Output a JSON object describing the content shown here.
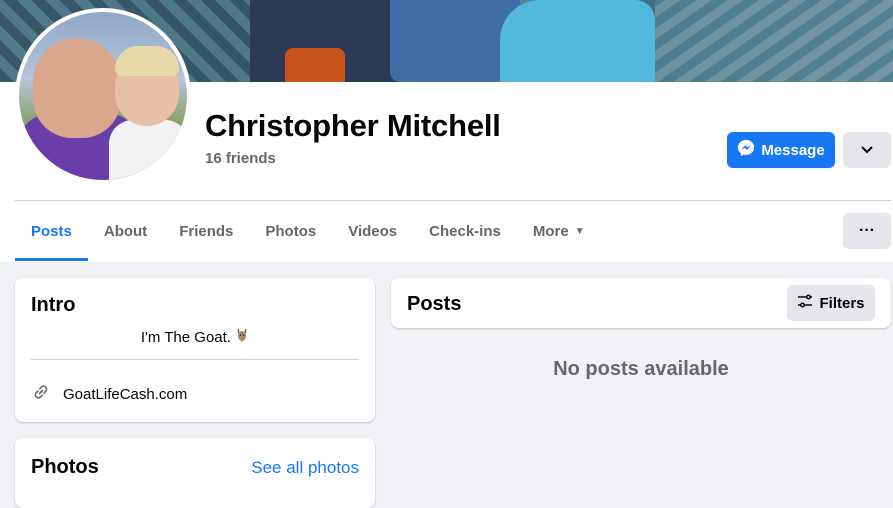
{
  "profile": {
    "name": "Christopher Mitchell",
    "friends": "16 friends"
  },
  "actions": {
    "message_label": "Message",
    "message_icon": "messenger-icon",
    "more_icon": "chevron-down-icon",
    "dots_label": "···"
  },
  "tabs": [
    {
      "label": "Posts",
      "active": true
    },
    {
      "label": "About"
    },
    {
      "label": "Friends"
    },
    {
      "label": "Photos"
    },
    {
      "label": "Videos"
    },
    {
      "label": "Check-ins"
    },
    {
      "label": "More"
    }
  ],
  "intro": {
    "title": "Intro",
    "bio": "I'm The Goat.",
    "bio_emoji": "goat-icon",
    "link": "GoatLifeCash.com"
  },
  "photos": {
    "title": "Photos",
    "see_all": "See all photos"
  },
  "posts": {
    "title": "Posts",
    "filters_label": "Filters",
    "empty_text": "No posts available"
  },
  "colors": {
    "accent": "#1877f2",
    "secondary_text": "#65676b",
    "button_bg": "#e4e6eb",
    "page_bg": "#f0f2f5"
  }
}
